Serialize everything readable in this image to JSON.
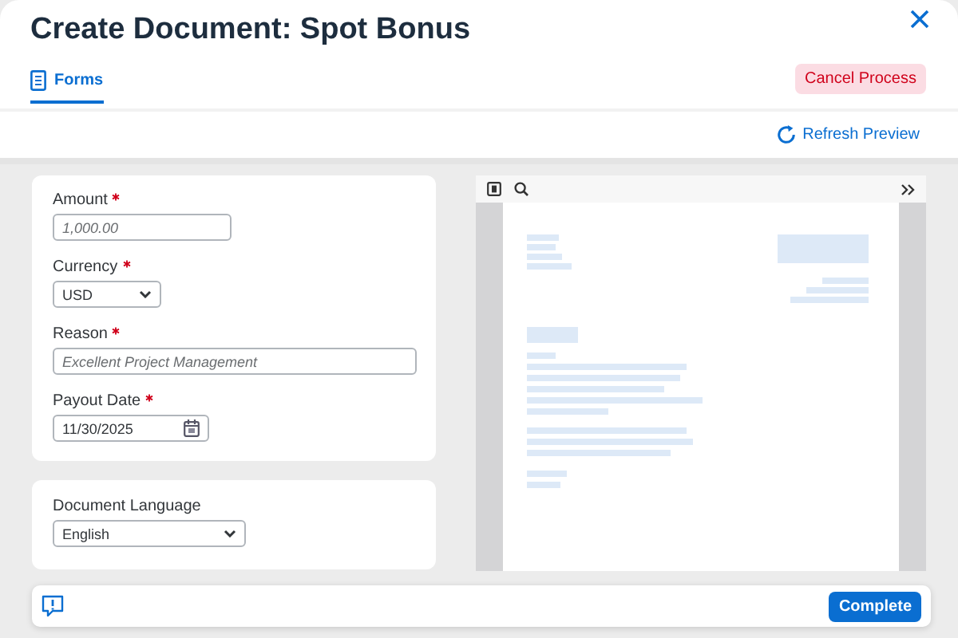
{
  "dialog": {
    "title": "Create Document: Spot Bonus"
  },
  "tabs": [
    {
      "label": "Forms",
      "selected": true
    }
  ],
  "cancel_button": "Cancel Process",
  "refresh_button": "Refresh Preview",
  "form_cards": [
    {
      "fields": [
        {
          "kind": "text",
          "label": "Amount",
          "required": true,
          "placeholder": "1,000.00"
        },
        {
          "kind": "select",
          "label": "Currency",
          "required": true,
          "value": "USD"
        },
        {
          "kind": "text",
          "label": "Reason",
          "required": true,
          "placeholder": "Excellent Project Management"
        },
        {
          "kind": "date",
          "label": "Payout Date",
          "required": true,
          "value": "11/30/2025"
        }
      ]
    },
    {
      "fields": [
        {
          "kind": "select",
          "label": "Document Language",
          "required": false,
          "value": "English"
        }
      ]
    }
  ],
  "footer": {
    "complete_button": "Complete"
  }
}
